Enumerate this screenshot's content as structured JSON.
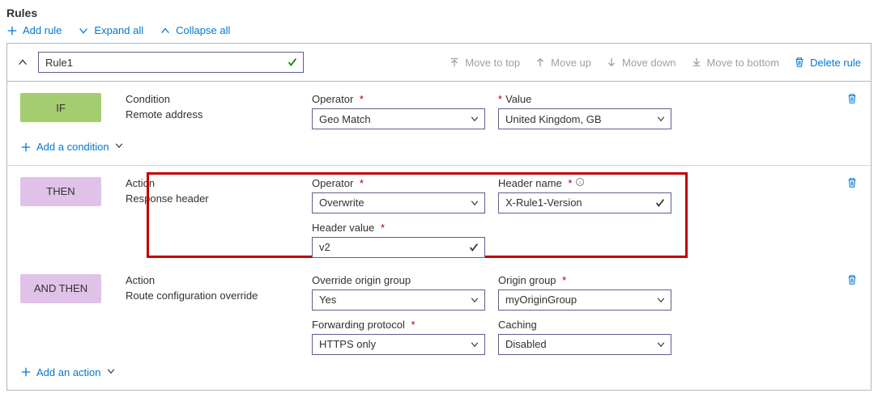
{
  "heading": "Rules",
  "toolbar": {
    "add_rule": "Add rule",
    "expand_all": "Expand all",
    "collapse_all": "Collapse all"
  },
  "rule": {
    "name": "Rule1",
    "header_actions": {
      "move_top": "Move to top",
      "move_up": "Move up",
      "move_down": "Move down",
      "move_bottom": "Move to bottom",
      "delete": "Delete rule"
    },
    "if": {
      "badge": "IF",
      "condition_label": "Condition",
      "condition_value": "Remote address",
      "operator_label": "Operator",
      "operator_value": "Geo Match",
      "value_label": "Value",
      "value_value": "United Kingdom, GB",
      "add_condition": "Add a condition"
    },
    "then": {
      "badge": "THEN",
      "action_label": "Action",
      "action_value": "Response header",
      "operator_label": "Operator",
      "operator_value": "Overwrite",
      "header_name_label": "Header name",
      "header_name_value": "X-Rule1-Version",
      "header_value_label": "Header value",
      "header_value_value": "v2"
    },
    "andthen": {
      "badge": "AND THEN",
      "action_label": "Action",
      "action_value": "Route configuration override",
      "override_label": "Override origin group",
      "override_value": "Yes",
      "origin_group_label": "Origin group",
      "origin_group_value": "myOriginGroup",
      "fwd_proto_label": "Forwarding protocol",
      "fwd_proto_value": "HTTPS only",
      "caching_label": "Caching",
      "caching_value": "Disabled",
      "add_action": "Add an action"
    }
  }
}
